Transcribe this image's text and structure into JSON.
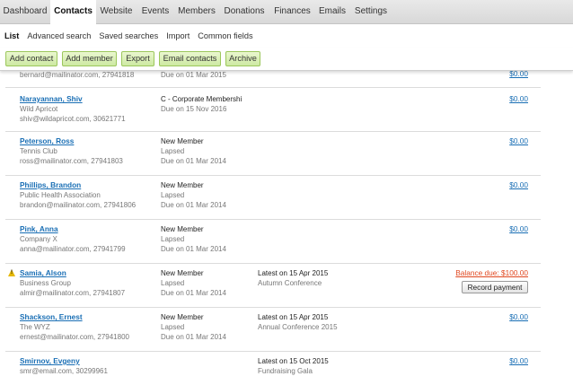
{
  "nav": {
    "tabs": [
      "Dashboard",
      "Contacts",
      "Website",
      "Events",
      "Members",
      "Donations",
      "Finances",
      "Emails",
      "Settings"
    ],
    "active": "Contacts"
  },
  "subnav": [
    "List",
    "Advanced search",
    "Saved searches",
    "Import",
    "Common fields"
  ],
  "toolbar": {
    "add_contact": "Add contact",
    "add_member": "Add member",
    "export": "Export",
    "email_contacts": "Email contacts",
    "archive": "Archive"
  },
  "contacts": [
    {
      "name": "",
      "org": "",
      "email_line": "bernard@mailinator.com, 27941818",
      "membership": "",
      "status": "",
      "due": "Due on 01 Mar 2015",
      "event_date": "",
      "event_name": "",
      "amount": "$0.00",
      "warning": false,
      "balance": "",
      "action": ""
    },
    {
      "name": "Narayannan, Shiv",
      "org": "Wild Apricot",
      "email_line": "shiv@wildapricot.com, 30621771",
      "membership": "C - Corporate Membershi",
      "status": "",
      "due": "Due on 15 Nov 2016",
      "event_date": "",
      "event_name": "",
      "amount": "$0.00",
      "warning": false,
      "balance": "",
      "action": ""
    },
    {
      "name": "Peterson, Ross",
      "org": "Tennis Club",
      "email_line": "ross@mailinator.com, 27941803",
      "membership": "New Member",
      "status": "Lapsed",
      "due": "Due on 01 Mar 2014",
      "event_date": "",
      "event_name": "",
      "amount": "$0.00",
      "warning": false,
      "balance": "",
      "action": ""
    },
    {
      "name": "Phillips, Brandon",
      "org": "Public Health Association",
      "email_line": "brandon@mailinator.com, 27941806",
      "membership": "New Member",
      "status": "Lapsed",
      "due": "Due on 01 Mar 2014",
      "event_date": "",
      "event_name": "",
      "amount": "$0.00",
      "warning": false,
      "balance": "",
      "action": ""
    },
    {
      "name": "Pink, Anna",
      "org": "Company X",
      "email_line": "anna@mailinator.com, 27941799",
      "membership": "New Member",
      "status": "Lapsed",
      "due": "Due on 01 Mar 2014",
      "event_date": "",
      "event_name": "",
      "amount": "$0.00",
      "warning": false,
      "balance": "",
      "action": ""
    },
    {
      "name": "Samia, Alson",
      "org": "Business Group",
      "email_line": "almir@mailinator.com, 27941807",
      "membership": "New Member",
      "status": "Lapsed",
      "due": "Due on 01 Mar 2014",
      "event_date": "Latest on 15 Apr 2015",
      "event_name": "Autumn Conference",
      "amount": "",
      "warning": true,
      "balance": "Balance due: $100.00",
      "action": "Record payment"
    },
    {
      "name": "Shackson, Ernest",
      "org": "The WYZ",
      "email_line": "ernest@mailinator.com, 27941800",
      "membership": "New Member",
      "status": "Lapsed",
      "due": "Due on 01 Mar 2014",
      "event_date": "Latest on 15 Apr 2015",
      "event_name": "Annual Conference 2015",
      "amount": "$0.00",
      "warning": false,
      "balance": "",
      "action": ""
    },
    {
      "name": "Smirnov, Evgeny",
      "org": "",
      "email_line": "smr@email.com, 30299961",
      "membership": "",
      "status": "",
      "due": "",
      "event_date": "Latest on 15 Oct 2015",
      "event_name": "Fundraising Gala",
      "amount": "$0.00",
      "warning": false,
      "balance": "",
      "action": ""
    }
  ]
}
